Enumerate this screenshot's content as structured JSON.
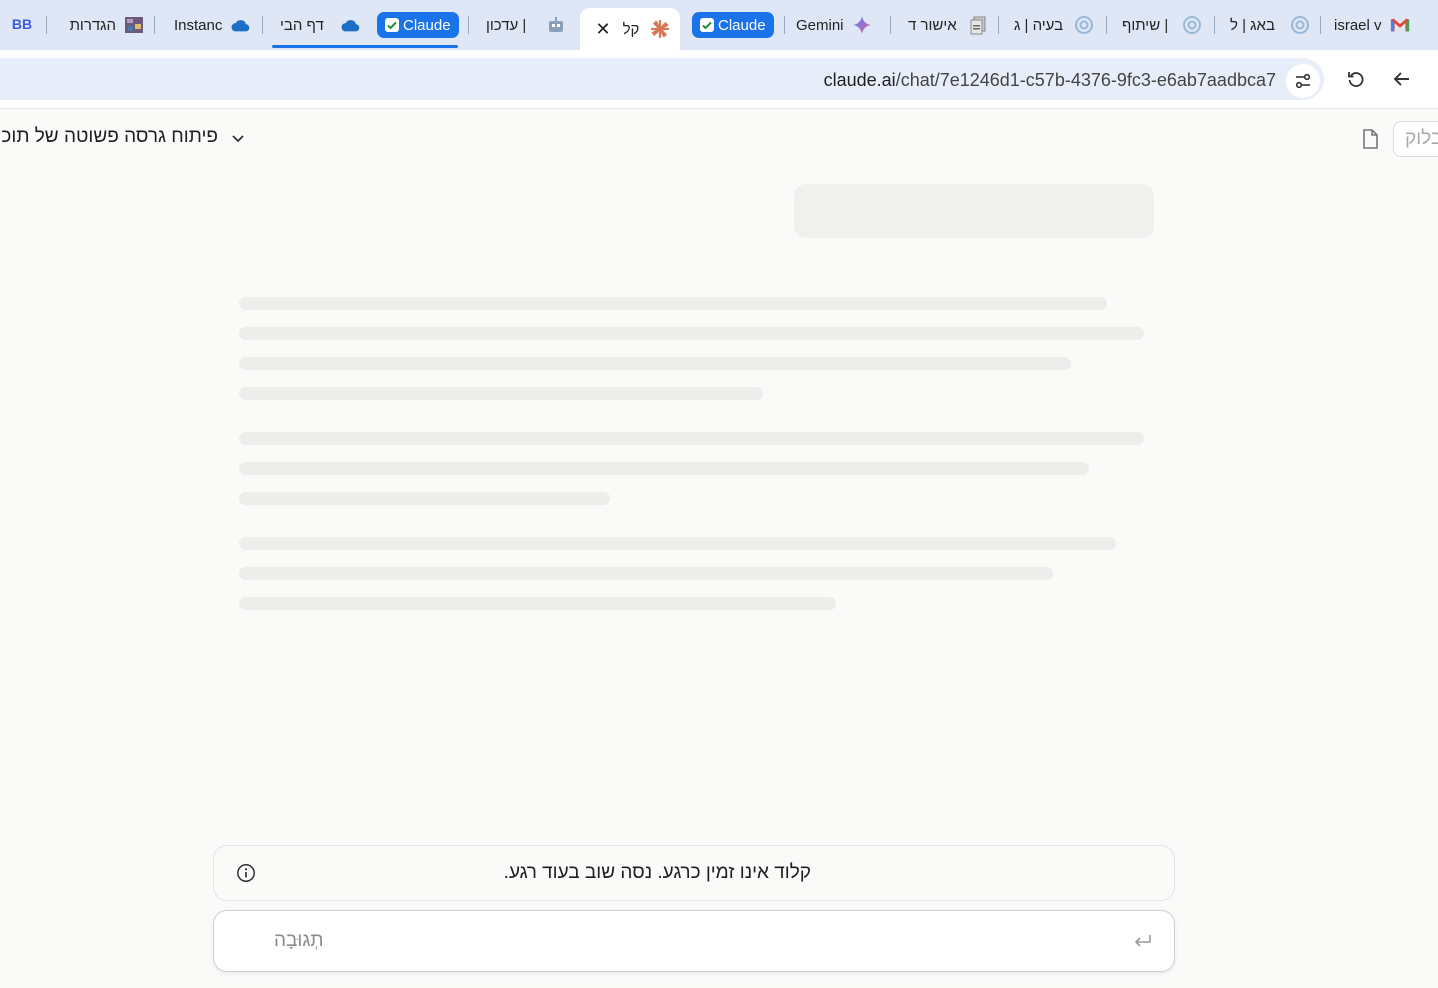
{
  "browser": {
    "tabs": [
      {
        "title": "הגדרות",
        "icon": "pixel-art-favicon"
      },
      {
        "title": "Instanc",
        "icon": "cloud-icon"
      },
      {
        "title": "דף הבי",
        "icon": "cloud-icon"
      },
      {
        "title": "עדכון |",
        "icon": "robot-favicon"
      },
      {
        "title": "קל",
        "icon": "claude-starburst-icon",
        "active": true
      },
      {
        "title": "Gemini",
        "icon": "gemini-sparkle-icon"
      },
      {
        "title": "אישור ד",
        "icon": "document-stack-favicon"
      },
      {
        "title": "בעיה | ג",
        "icon": "openai-icon"
      },
      {
        "title": "שיתוף |",
        "icon": "openai-icon"
      },
      {
        "title": "באג | ל",
        "icon": "openai-icon"
      },
      {
        "title": "israel vi",
        "icon": "gmail-icon"
      }
    ],
    "tab_groups": [
      {
        "label": "Claude"
      },
      {
        "label": "Claude"
      }
    ],
    "pinned_badge": "BB",
    "url_host": "claude.ai",
    "url_path": "/chat/7e1246d1-c57b-4376-9fc3-e6ab7aadbca7",
    "accent_color": "#1a73e8"
  },
  "chat": {
    "title": "פיתוח גרסה פשוטה של תוכנה",
    "share_label": "פרסום בלוק",
    "notice": "קלוד אינו זמין כרגע. נסה שוב בעוד רגע.",
    "input_placeholder": "תְגוּבָה"
  }
}
